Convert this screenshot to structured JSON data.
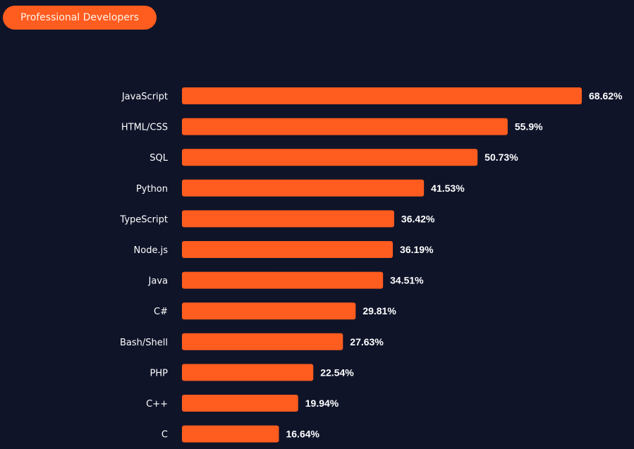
{
  "filter": {
    "label": "Professional Developers"
  },
  "colors": {
    "bar": "#ff5c1f",
    "background": "#0f1429",
    "text": "#ffffff"
  },
  "chart_data": {
    "type": "bar",
    "orientation": "horizontal",
    "title": "",
    "xlabel": "",
    "ylabel": "",
    "xlim": [
      0,
      68.62
    ],
    "grid": false,
    "categories": [
      "JavaScript",
      "HTML/CSS",
      "SQL",
      "Python",
      "TypeScript",
      "Node.js",
      "Java",
      "C#",
      "Bash/Shell",
      "PHP",
      "C++",
      "C"
    ],
    "values": [
      68.62,
      55.9,
      50.73,
      41.53,
      36.42,
      36.19,
      34.51,
      29.81,
      27.63,
      22.54,
      19.94,
      16.64
    ],
    "value_labels": [
      "68.62%",
      "55.9%",
      "50.73%",
      "41.53%",
      "36.42%",
      "36.19%",
      "34.51%",
      "29.81%",
      "27.63%",
      "22.54%",
      "19.94%",
      "16.64%"
    ]
  }
}
